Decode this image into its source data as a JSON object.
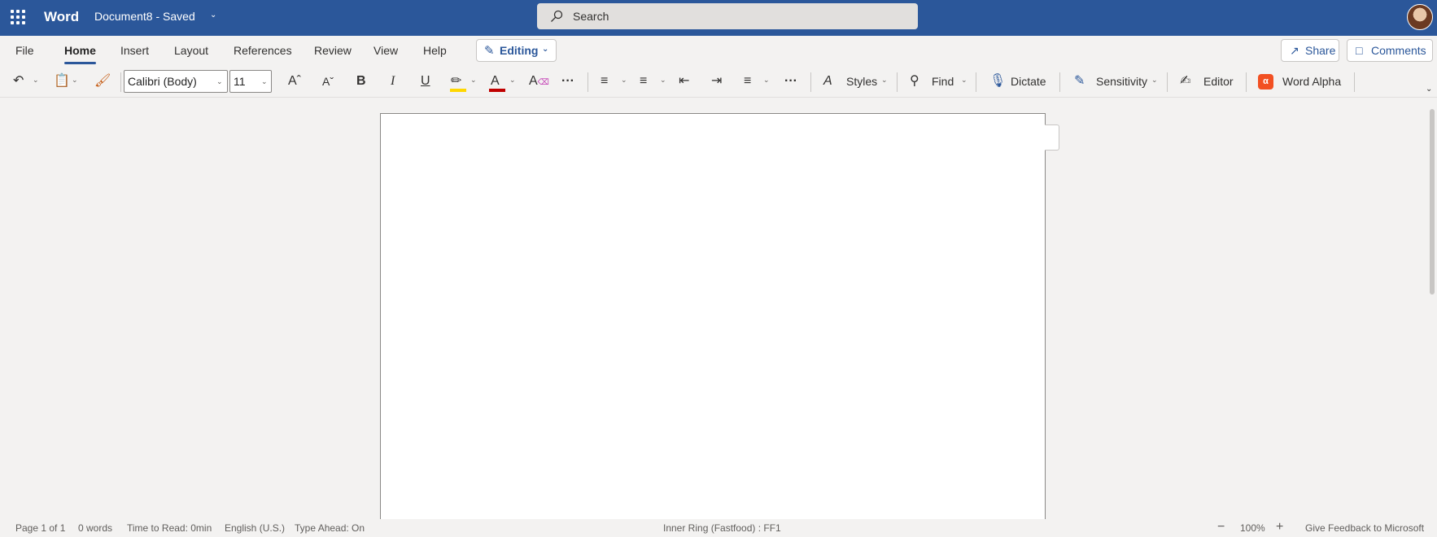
{
  "app": {
    "name": "Word",
    "document_title": "Document8 - Saved",
    "search_placeholder": "Search"
  },
  "tabs": [
    "File",
    "Home",
    "Insert",
    "Layout",
    "References",
    "Review",
    "View",
    "Help"
  ],
  "active_tab": "Home",
  "header_buttons": {
    "editing": "Editing",
    "share": "Share",
    "comments": "Comments"
  },
  "toolbar": {
    "font_name": "Calibri (Body)",
    "font_size": "11",
    "styles_label": "Styles",
    "find_label": "Find",
    "dictate_label": "Dictate",
    "sensitivity_label": "Sensitivity",
    "editor_label": "Editor",
    "word_alpha_label": "Word Alpha"
  },
  "colors": {
    "brand": "#2b579a",
    "highlight": "#ffd700",
    "font_color": "#c00000",
    "word_alpha": "#f25022"
  },
  "status": {
    "page": "Page 1 of 1",
    "words": "0 words",
    "time_to_read": "Time to Read: 0min",
    "language": "English (U.S.)",
    "type_ahead": "Type Ahead: On",
    "ring": "Inner Ring (Fastfood) : FF1",
    "zoom": "100%",
    "feedback": "Give Feedback to Microsoft"
  }
}
